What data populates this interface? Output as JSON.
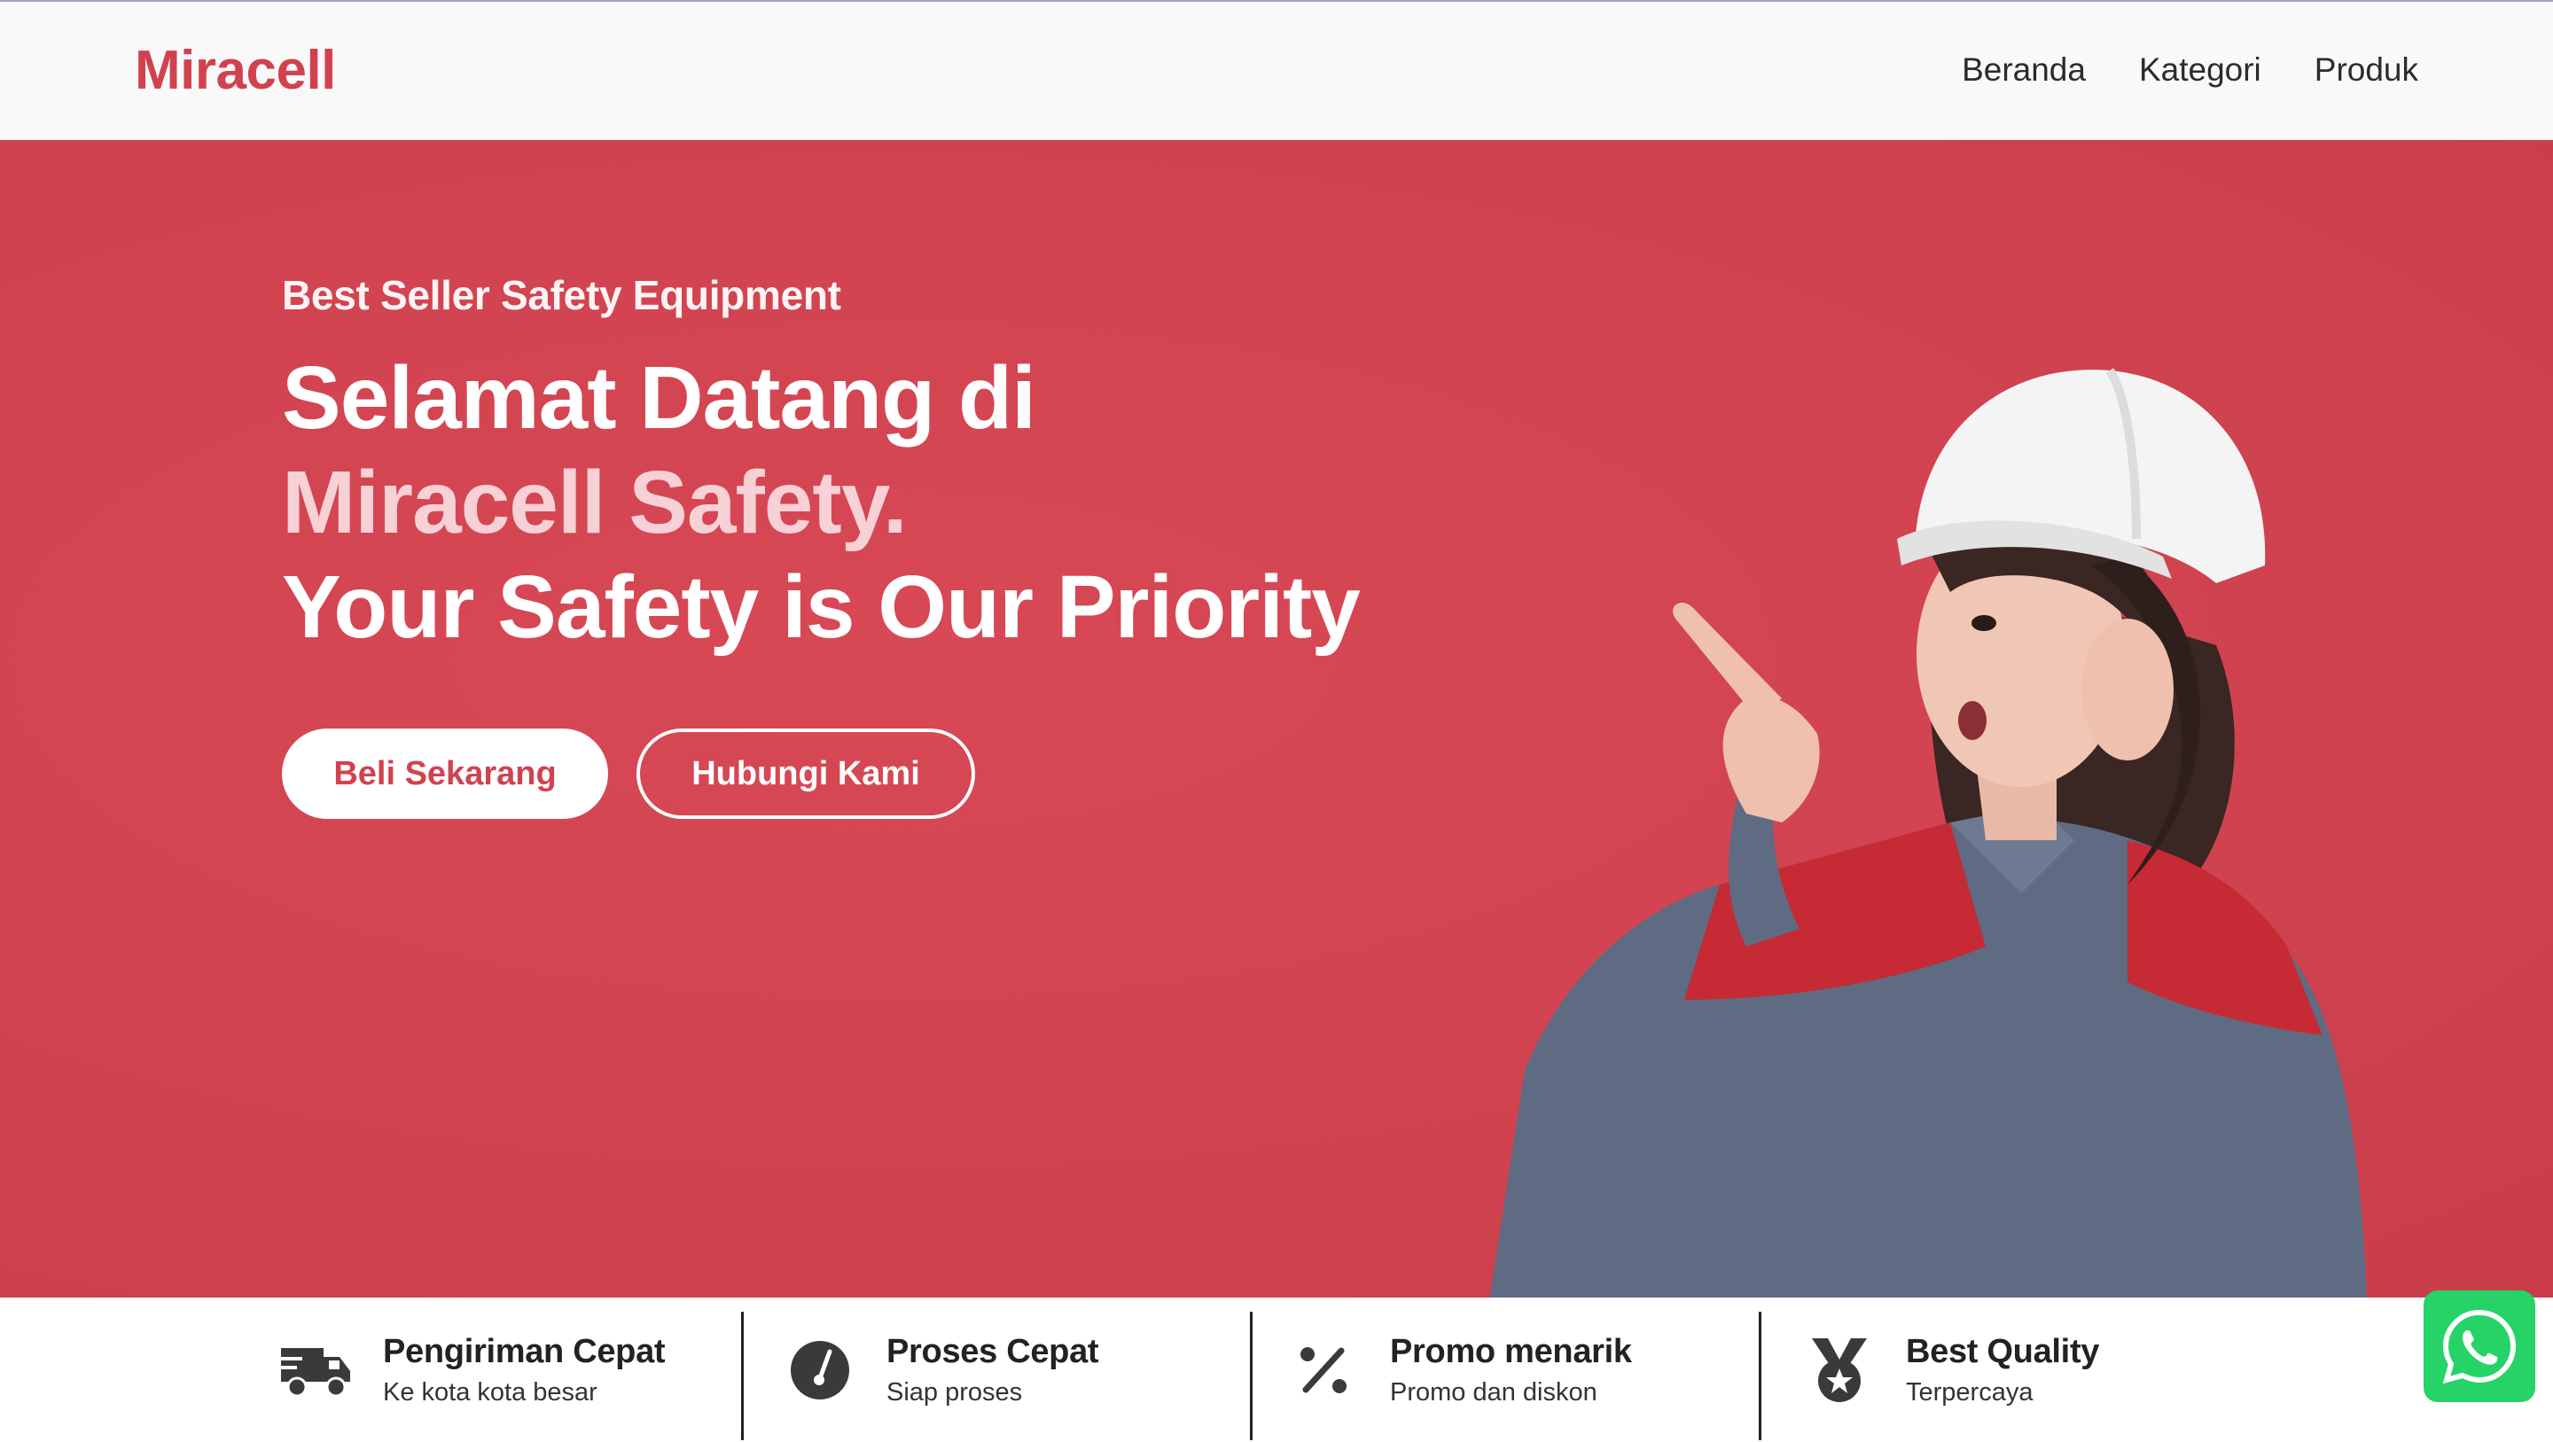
{
  "brand": {
    "name": "Miracell"
  },
  "nav": {
    "items": [
      {
        "label": "Beranda"
      },
      {
        "label": "Kategori"
      },
      {
        "label": "Produk"
      }
    ]
  },
  "hero": {
    "eyebrow": "Best Seller Safety Equipment",
    "headline_line1": "Selamat Datang di",
    "headline_accent": "Miracell Safety.",
    "headline_line3": "Your Safety is Our Priority",
    "primary_button": "Beli Sekarang",
    "secondary_button": "Hubungi Kami"
  },
  "features": [
    {
      "icon": "truck-icon",
      "title": "Pengiriman Cepat",
      "subtitle": "Ke kota kota besar"
    },
    {
      "icon": "gauge-icon",
      "title": "Proses Cepat",
      "subtitle": "Siap proses"
    },
    {
      "icon": "percent-icon",
      "title": "Promo menarik",
      "subtitle": "Promo dan diskon"
    },
    {
      "icon": "medal-icon",
      "title": "Best Quality",
      "subtitle": "Terpercaya"
    }
  ],
  "colors": {
    "brand": "#d1424f",
    "hero_bg": "#d24451",
    "accent_text": "#f7d1d6",
    "whatsapp": "#25d366"
  },
  "floating": {
    "icon": "whatsapp-icon"
  }
}
